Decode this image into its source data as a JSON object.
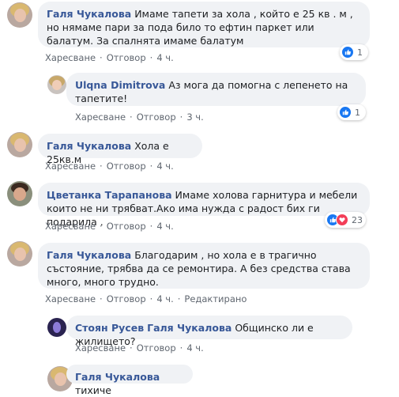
{
  "colors": {
    "link": "#385898",
    "bubble": "#f0f2f5",
    "meta": "#606770",
    "like": "#1877f2",
    "love": "#f33e58"
  },
  "comments": [
    {
      "author": "Галя Чукалова",
      "text": "Имаме тапети за хола , който е 25 кв . м , но нямаме пари за пода било то ефтин паркет или балатум. За спалнята имаме балатум",
      "like_label": "Харесване",
      "reply_label": "Отговор",
      "time": "4 ч.",
      "reactions": {
        "icons": [
          "like-icon"
        ],
        "count": "1"
      }
    },
    {
      "author": "Ulqna Dimitrova",
      "text": "Аз мога да помогна с лепенето на тапетите!",
      "like_label": "Харесване",
      "reply_label": "Отговор",
      "time": "3 ч.",
      "reactions": {
        "icons": [
          "like-icon"
        ],
        "count": "1"
      }
    },
    {
      "author": "Галя Чукалова",
      "text": "Хола е 25кв.м",
      "like_label": "Харесване",
      "reply_label": "Отговор",
      "time": "4 ч."
    },
    {
      "author": "Цветанка Тарапанова",
      "text": "Имаме холова гарнитура и мебели които не ни трябват.Ако има нужда с радост бих ги подарила .",
      "like_label": "Харесване",
      "reply_label": "Отговор",
      "time": "4 ч.",
      "reactions": {
        "icons": [
          "like-icon",
          "love-icon"
        ],
        "count": "23"
      }
    },
    {
      "author": "Галя Чукалова",
      "text": "Благодарим , но хола е в трагично състояние, трябва да се ремонтира. А без средства става много, много трудно.",
      "like_label": "Харесване",
      "reply_label": "Отговор",
      "time": "4 ч.",
      "edited_label": "Редактирано"
    },
    {
      "author": "Стоян Русев",
      "mention": "Галя Чукалова",
      "text": "Общинско ли е жилището?",
      "like_label": "Харесване",
      "reply_label": "Отговор",
      "time": "4 ч."
    },
    {
      "author": "Галя Чукалова",
      "text": "тихиче"
    }
  ]
}
